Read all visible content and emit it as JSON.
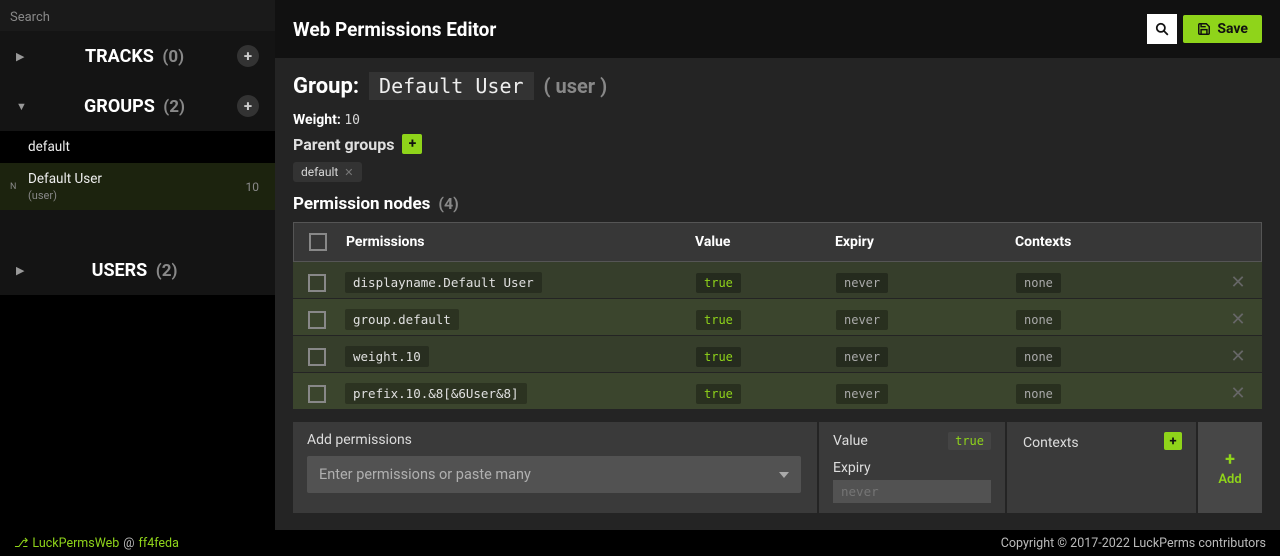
{
  "sidebar": {
    "search_placeholder": "Search",
    "tracks": {
      "label": "TRACKS",
      "count": "(0)"
    },
    "groups": {
      "label": "GROUPS",
      "count": "(2)",
      "items": [
        {
          "name": "default",
          "sub": "",
          "meta": "",
          "selected": false,
          "badge": ""
        },
        {
          "name": "Default User",
          "sub": "(user)",
          "meta": "10",
          "selected": true,
          "badge": "N"
        }
      ]
    },
    "users": {
      "label": "USERS",
      "count": "(2)"
    }
  },
  "topbar": {
    "title": "Web Permissions Editor",
    "save": "Save"
  },
  "group": {
    "prefix": "Group:",
    "display": "Default User",
    "key": "( user )",
    "weight_label": "Weight:",
    "weight_value": "10",
    "parents_label": "Parent groups",
    "parents": [
      "default"
    ]
  },
  "nodes": {
    "title": "Permission nodes",
    "count": "(4)",
    "cols": {
      "perm": "Permissions",
      "value": "Value",
      "expiry": "Expiry",
      "ctx": "Contexts"
    },
    "rows": [
      {
        "perm": "displayname.Default User",
        "value": "true",
        "expiry": "never",
        "ctx": "none"
      },
      {
        "perm": "group.default",
        "value": "true",
        "expiry": "never",
        "ctx": "none"
      },
      {
        "perm": "weight.10",
        "value": "true",
        "expiry": "never",
        "ctx": "none"
      },
      {
        "perm": "prefix.10.&8[&6User&8]",
        "value": "true",
        "expiry": "never",
        "ctx": "none"
      }
    ]
  },
  "add": {
    "title": "Add permissions",
    "placeholder": "Enter permissions or paste many",
    "value_label": "Value",
    "value_val": "true",
    "expiry_label": "Expiry",
    "expiry_placeholder": "never",
    "ctx_label": "Contexts",
    "add_label": "Add"
  },
  "footer": {
    "brand": "LuckPermsWeb",
    "sep": "@",
    "hash": "ff4feda",
    "right": "Copyright © 2017-2022 LuckPerms contributors"
  }
}
